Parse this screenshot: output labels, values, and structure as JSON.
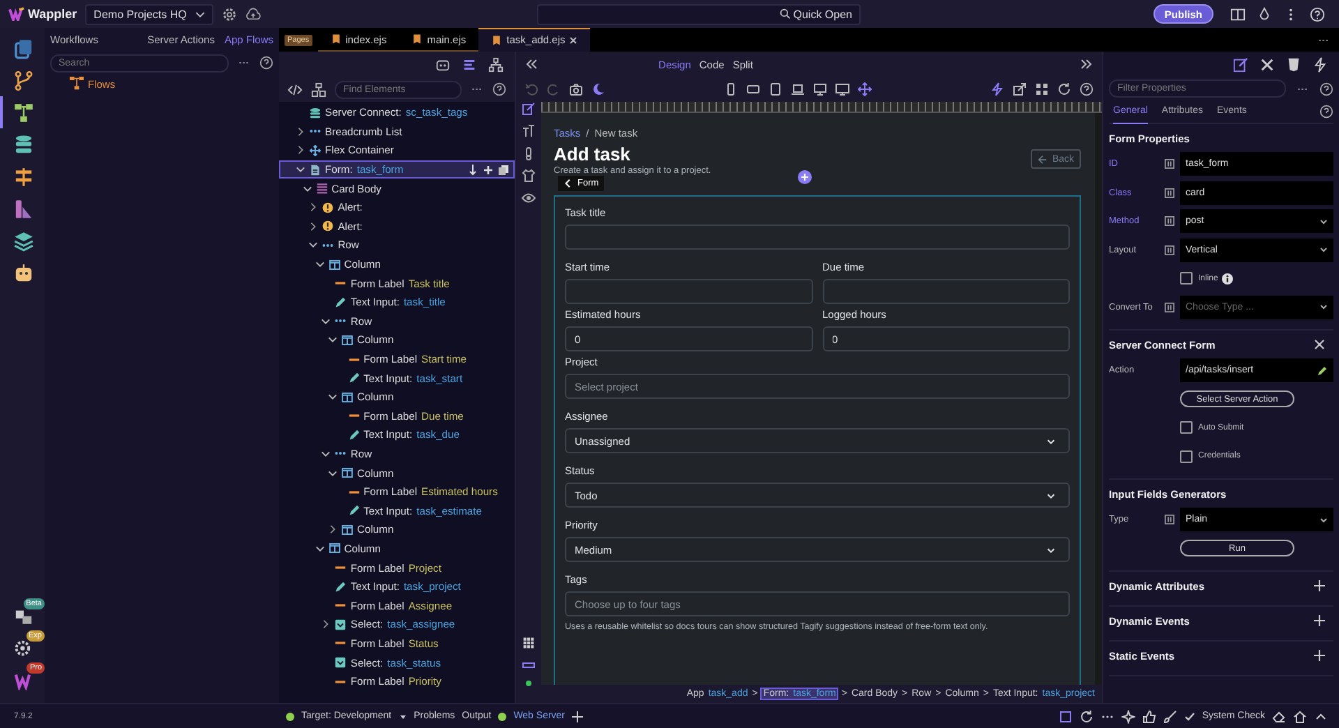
{
  "app": {
    "logo": "Wappler",
    "project": "Demo Projects HQ",
    "quick_open": "Quick Open",
    "publish": "Publish",
    "version": "7.9.2"
  },
  "rail": [
    {
      "kind": "pages",
      "selected": false
    },
    {
      "kind": "git",
      "selected": false
    },
    {
      "kind": "flows",
      "selected": true
    },
    {
      "kind": "database",
      "selected": false
    },
    {
      "kind": "routes",
      "selected": false
    },
    {
      "kind": "theme",
      "selected": false
    },
    {
      "kind": "layers",
      "selected": false
    },
    {
      "kind": "robot",
      "selected": false
    }
  ],
  "rail_bottom": [
    {
      "kind": "extensions",
      "badge": "Beta",
      "color": "#3f8f86"
    },
    {
      "kind": "settings",
      "badge": "Exp",
      "color": "#c79a3a"
    },
    {
      "kind": "brand",
      "badge": "Pro",
      "color": "#c0392b"
    }
  ],
  "sidebar": {
    "title": "Workflows",
    "tabs": [
      {
        "label": "Server Actions",
        "selected": false
      },
      {
        "label": "App Flows",
        "selected": true
      }
    ],
    "search_placeholder": "Search",
    "items": [
      {
        "label": "Flows"
      }
    ]
  },
  "editor_tabs": {
    "group": "Pages",
    "tabs": [
      {
        "label": "index.ejs",
        "selected": false
      },
      {
        "label": "main.ejs",
        "selected": false
      },
      {
        "label": "task_add.ejs",
        "selected": true
      }
    ]
  },
  "structure": {
    "search_placeholder": "Find Elements",
    "nodes": [
      {
        "kind": "server-connect",
        "label": "Server Connect:",
        "name": "sc_task_tags",
        "selected": false
      },
      {
        "kind": "breadcrumb",
        "label": "Breadcrumb List",
        "expanded": false,
        "selected": false
      },
      {
        "kind": "flex",
        "label": "Flex Container",
        "expanded": false,
        "selected": false
      },
      {
        "kind": "form",
        "label": "Form:",
        "name": "task_form",
        "expanded": true,
        "selected": true,
        "children": [
          {
            "kind": "card-body",
            "label": "Card Body",
            "expanded": true,
            "selected": false,
            "children": [
              {
                "kind": "alert",
                "label": "Alert:",
                "expanded": false,
                "selected": false
              },
              {
                "kind": "alert",
                "label": "Alert:",
                "expanded": false,
                "selected": false
              },
              {
                "kind": "row",
                "label": "Row",
                "expanded": true,
                "selected": false,
                "children": [
                  {
                    "kind": "column",
                    "label": "Column",
                    "expanded": true,
                    "selected": false,
                    "children": [
                      {
                        "kind": "label",
                        "label": "Form Label",
                        "name": "Task title",
                        "selected": false
                      },
                      {
                        "kind": "input",
                        "label": "Text Input:",
                        "name": "task_title",
                        "selected": false
                      },
                      {
                        "kind": "row",
                        "label": "Row",
                        "expanded": true,
                        "selected": false,
                        "children": [
                          {
                            "kind": "column",
                            "label": "Column",
                            "expanded": true,
                            "selected": false,
                            "children": [
                              {
                                "kind": "label",
                                "label": "Form Label",
                                "name": "Start time",
                                "selected": false
                              },
                              {
                                "kind": "input",
                                "label": "Text Input:",
                                "name": "task_start",
                                "selected": false
                              }
                            ]
                          },
                          {
                            "kind": "column",
                            "label": "Column",
                            "expanded": true,
                            "selected": false,
                            "children": [
                              {
                                "kind": "label",
                                "label": "Form Label",
                                "name": "Due time",
                                "selected": false
                              },
                              {
                                "kind": "input",
                                "label": "Text Input:",
                                "name": "task_due",
                                "selected": false
                              }
                            ]
                          }
                        ]
                      },
                      {
                        "kind": "row",
                        "label": "Row",
                        "expanded": true,
                        "selected": false,
                        "children": [
                          {
                            "kind": "column",
                            "label": "Column",
                            "expanded": true,
                            "selected": false,
                            "children": [
                              {
                                "kind": "label",
                                "label": "Form Label",
                                "name": "Estimated hours",
                                "selected": false
                              },
                              {
                                "kind": "input",
                                "label": "Text Input:",
                                "name": "task_estimate",
                                "selected": false
                              }
                            ]
                          },
                          {
                            "kind": "column",
                            "label": "Column",
                            "expanded": false,
                            "selected": false
                          }
                        ]
                      }
                    ]
                  },
                  {
                    "kind": "column",
                    "label": "Column",
                    "expanded": true,
                    "selected": false,
                    "children": [
                      {
                        "kind": "label",
                        "label": "Form Label",
                        "name": "Project",
                        "selected": false
                      },
                      {
                        "kind": "input",
                        "label": "Text Input:",
                        "name": "task_project",
                        "selected": false
                      },
                      {
                        "kind": "label",
                        "label": "Form Label",
                        "name": "Assignee",
                        "selected": false
                      },
                      {
                        "kind": "select",
                        "label": "Select:",
                        "name": "task_assignee",
                        "expanded": false,
                        "selected": false
                      },
                      {
                        "kind": "label",
                        "label": "Form Label",
                        "name": "Status",
                        "selected": false
                      },
                      {
                        "kind": "select",
                        "label": "Select:",
                        "name": "task_status",
                        "selected": false
                      },
                      {
                        "kind": "label",
                        "label": "Form Label",
                        "name": "Priority",
                        "selected": false
                      }
                    ]
                  }
                ]
              }
            ]
          }
        ]
      }
    ]
  },
  "canvas": {
    "view_modes": [
      {
        "label": "Design",
        "selected": true
      },
      {
        "label": "Code",
        "selected": false
      },
      {
        "label": "Split",
        "selected": false
      }
    ],
    "breadcrumb": [
      {
        "label": "Tasks",
        "link": true
      },
      {
        "label": "New task",
        "link": false
      }
    ],
    "breadcrumb_separator": "/",
    "path_separator": ">",
    "heading": "Add task",
    "subtitle": "Create a task and assign it to a project.",
    "back": "Back",
    "selection_tag": "Form",
    "rows": [
      {
        "fields": [
          {
            "kind": "input",
            "label": "Task title"
          }
        ]
      },
      {
        "fields": [
          {
            "kind": "input",
            "label": "Start time"
          },
          {
            "kind": "input",
            "label": "Due time"
          }
        ]
      },
      {
        "fields": [
          {
            "kind": "input",
            "label": "Estimated hours",
            "value": "0"
          },
          {
            "kind": "input",
            "label": "Logged hours",
            "value": "0"
          }
        ]
      },
      {
        "fields": [
          {
            "kind": "input",
            "label": "Project",
            "placeholder": "Select project"
          }
        ]
      },
      {
        "fields": [
          {
            "kind": "select",
            "label": "Assignee",
            "value": "Unassigned"
          }
        ]
      },
      {
        "fields": [
          {
            "kind": "select",
            "label": "Status",
            "value": "Todo"
          }
        ]
      },
      {
        "fields": [
          {
            "kind": "select",
            "label": "Priority",
            "value": "Medium"
          }
        ]
      },
      {
        "fields": [
          {
            "kind": "input",
            "label": "Tags",
            "placeholder": "Choose up to four tags",
            "help": "Uses a reusable whitelist so docs tours can show structured Tagify suggestions instead of free-form text only."
          }
        ]
      }
    ],
    "path": [
      {
        "label": "App",
        "name": "task_add",
        "selected": false
      },
      {
        "label": "Form:",
        "name": "task_form",
        "selected": true
      },
      {
        "label": "Card Body",
        "selected": false
      },
      {
        "label": "Row",
        "selected": false
      },
      {
        "label": "Column",
        "selected": false
      },
      {
        "label": "Text Input:",
        "name": "task_project",
        "selected": false
      }
    ]
  },
  "properties": {
    "search_placeholder": "Filter Properties",
    "tabs": [
      {
        "label": "General",
        "selected": true
      },
      {
        "label": "Attributes",
        "selected": false
      },
      {
        "label": "Events",
        "selected": false
      }
    ],
    "sections": [
      {
        "title": "Form Properties",
        "rows": [
          {
            "kind": "text",
            "label": "ID",
            "value": "task_form",
            "modified": true
          },
          {
            "kind": "text",
            "label": "Class",
            "value": "card",
            "modified": true
          },
          {
            "kind": "select",
            "label": "Method",
            "value": "post",
            "modified": true
          },
          {
            "kind": "select",
            "label": "Layout",
            "value": "Vertical",
            "modified": false
          },
          {
            "kind": "checkbox",
            "label": "Inline",
            "checked": false,
            "info": true
          },
          {
            "kind": "select",
            "label": "Convert To",
            "placeholder": "Choose Type ...",
            "modified": false
          }
        ]
      },
      {
        "title": "Server Connect Form",
        "closable": true,
        "rows": [
          {
            "kind": "action",
            "label": "Action",
            "value": "/api/tasks/insert",
            "modified": false
          },
          {
            "kind": "button",
            "label": "Select Server Action"
          },
          {
            "kind": "checkbox",
            "label": "Auto Submit",
            "checked": false,
            "info": false
          },
          {
            "kind": "checkbox",
            "label": "Credentials",
            "checked": false,
            "info": false
          }
        ]
      },
      {
        "title": "Input Fields Generators",
        "rows": [
          {
            "kind": "select",
            "label": "Type",
            "value": "Plain",
            "modified": false
          },
          {
            "kind": "button",
            "label": "Run"
          }
        ]
      },
      {
        "title": "Dynamic Attributes",
        "addable": true
      },
      {
        "title": "Dynamic Events",
        "addable": true
      },
      {
        "title": "Static Events",
        "addable": true
      }
    ]
  },
  "status_bar": {
    "target": "Target: Development",
    "items": [
      "Problems",
      "Output"
    ],
    "server": "Web Server",
    "system_check": "System Check"
  }
}
